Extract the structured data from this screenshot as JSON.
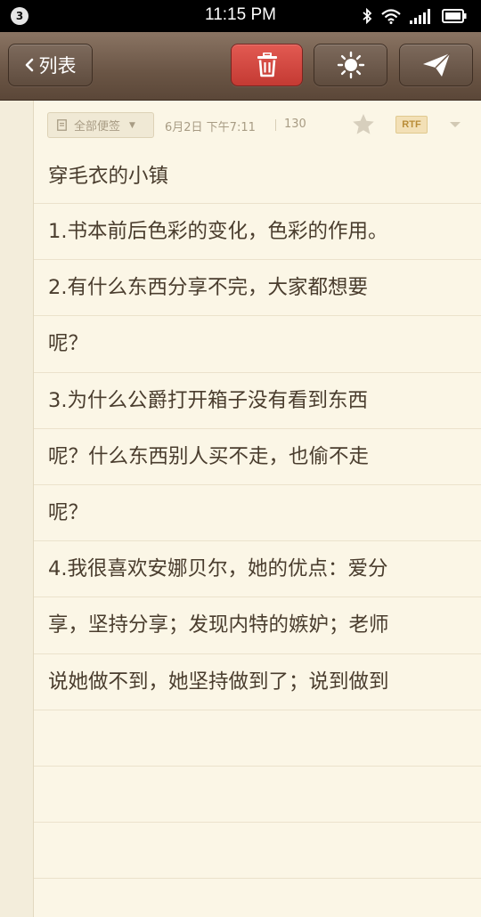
{
  "status_bar": {
    "notification_count": "3",
    "time": "11:15 PM",
    "icons": [
      "bluetooth-icon",
      "wifi-icon",
      "signal-icon",
      "battery-icon"
    ]
  },
  "toolbar": {
    "back_label": "列表",
    "accent_delete": "#d9463f",
    "icons": [
      "chevron-left-icon",
      "trash-icon",
      "brightness-icon",
      "send-icon"
    ]
  },
  "note": {
    "folder_label": "全部便签",
    "date": "6月2日 下午7:11",
    "char_count": "130",
    "format_badge": "RTF",
    "lines": [
      "穿毛衣的小镇",
      "1.书本前后色彩的变化，色彩的作用。",
      "2.有什么东西分享不完，大家都想要",
      "呢？",
      "3.为什么公爵打开箱子没有看到东西",
      "呢？什么东西别人买不走，也偷不走",
      "呢？",
      "4.我很喜欢安娜贝尔，她的优点：爱分",
      "享，坚持分享；发现内特的嫉妒；老师",
      "说她做不到，她坚持做到了；说到做到",
      "",
      "",
      "",
      ""
    ]
  }
}
